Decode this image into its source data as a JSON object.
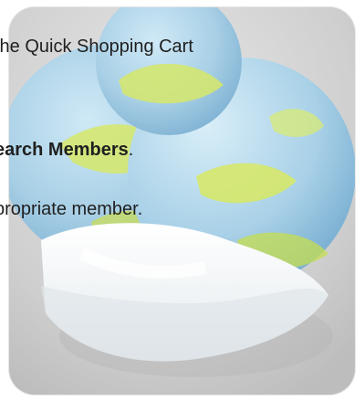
{
  "doc": {
    "line1": "the Quick Shopping Cart",
    "line2_bold": "earch Members",
    "line2_tail": ".",
    "line3": "propriate member."
  },
  "image": {
    "icon": "network-globe-illustration-icon",
    "colors": {
      "panel": "#d9d9d9",
      "globe_blue": "#a9d0e6",
      "globe_green": "#d6e86a",
      "tray_white": "#f2f4f5",
      "shadow_gray": "#bfbfbf"
    }
  }
}
